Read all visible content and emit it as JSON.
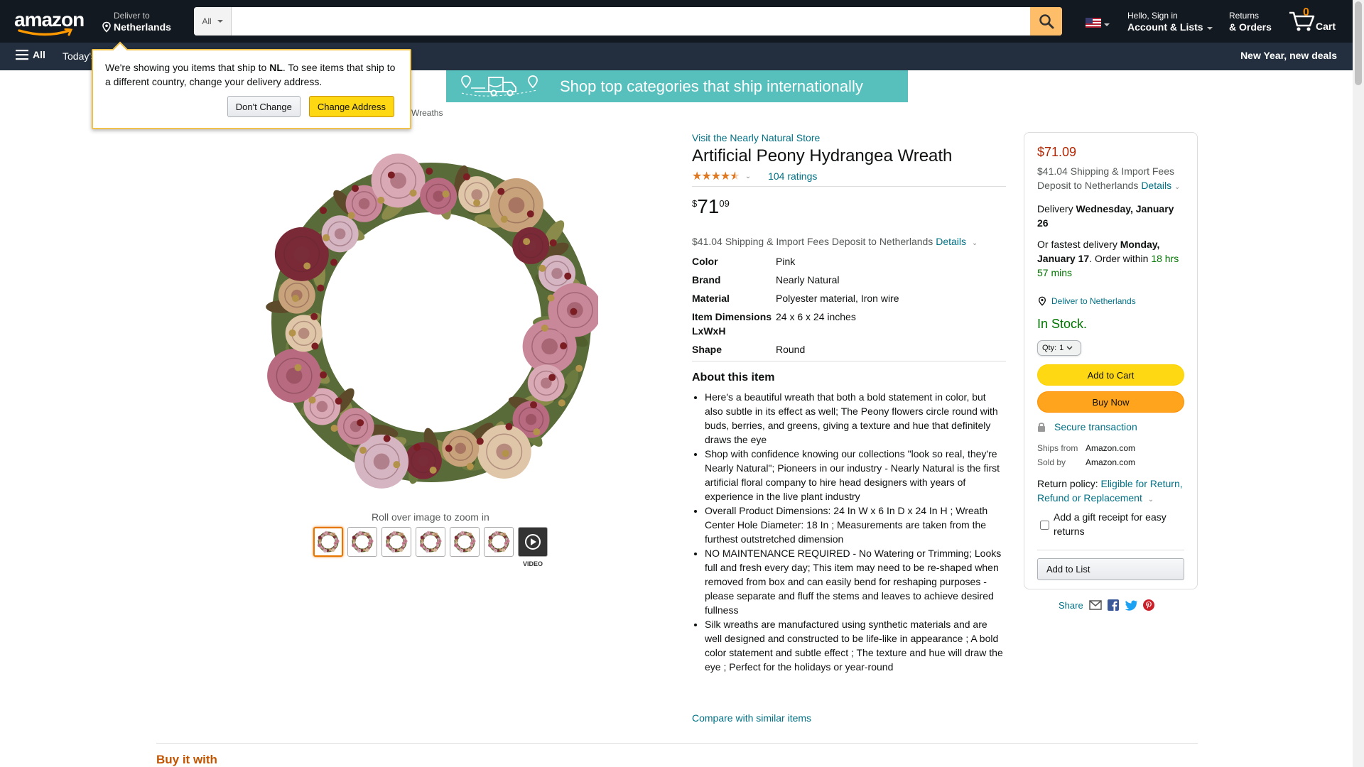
{
  "nav": {
    "logo_text": "amazon",
    "deliver_line1": "Deliver to",
    "deliver_line2": "Netherlands",
    "search_category": "All",
    "search_placeholder": "",
    "account_line1": "Hello, Sign in",
    "account_line2": "Account & Lists",
    "returns_line1": "Returns",
    "returns_line2": "& Orders",
    "cart_count": "0",
    "cart_label": "Cart",
    "all_label": "All",
    "today_label": "Today's",
    "promo": "New Year, new deals"
  },
  "popover": {
    "msg_prefix": "We're showing you items that ship to ",
    "msg_country": "NL",
    "msg_suffix": ". To see items that ship to a different country, change your delivery address.",
    "dont_change": "Don't Change",
    "change_address": "Change Address"
  },
  "banner": {
    "text": "Shop top categories that ship internationally"
  },
  "breadcrumb": "Wreaths",
  "gallery": {
    "zoom_hint": "Roll over image to zoom in",
    "video_label": "VIDEO",
    "thumb_count": 7
  },
  "product": {
    "store_link": "Visit the Nearly Natural Store",
    "title": "Artificial Peony Hydrangea Wreath",
    "rating_value": 4.5,
    "ratings": "104 ratings",
    "price_symbol": "$",
    "price_whole": "71",
    "price_fraction": "09",
    "shipping_text": "$41.04 Shipping & Import Fees Deposit to Netherlands",
    "details_link": "Details",
    "attributes": [
      {
        "k": "Color",
        "v": "Pink"
      },
      {
        "k": "Brand",
        "v": "Nearly Natural"
      },
      {
        "k": "Material",
        "v": "Polyester material, Iron wire"
      },
      {
        "k": "Item Dimensions LxWxH",
        "v": "24 x 6 x 24 inches"
      },
      {
        "k": "Shape",
        "v": "Round"
      }
    ],
    "about_heading": "About this item",
    "bullets": [
      "Here's a beautiful wreath that both a bold statement in color, but also subtle in its effect as well; The Peony flowers circle round with buds, berries, and greens, giving a texture and hue that definitely draws the eye",
      "Shop with confidence knowing our collections \"look so real, they're Nearly Natural\"; Pioneers in our industry - Nearly Natural is the first artificial floral company to hire head designers with years of experience in the live plant industry",
      "Overall Product Dimensions: 24 In W x 6 In D x 24 In H ; Wreath Center Hole Diameter: 18 In ; Measurements are taken from the furthest outstretched dimension",
      "NO MAINTENANCE REQUIRED - No Watering or Trimming; Looks full and fresh every day; This item may need to be re-shaped when removed from box and can easily bend for reshaping purposes - please separate and fluff the stems and leaves to achieve desired fullness",
      "Silk wreaths are manufactured using synthetic materials and are well designed and constructed to be life-like in appearance ; A bold color statement and subtle effect ; The texture and hue will draw the eye ; Perfect for the holidays or year-round"
    ],
    "compare_link": "Compare with similar items"
  },
  "buybox": {
    "price": "$71.09",
    "shipping_line": "$41.04 Shipping & Import Fees Deposit to Netherlands",
    "details_link": "Details",
    "delivery_prefix": "Delivery ",
    "delivery_date": "Wednesday, January 26",
    "fastest_prefix": "Or fastest delivery ",
    "fastest_date": "Monday, January 17",
    "order_within": ". Order within ",
    "countdown": "18 hrs 57 mins",
    "deliver_to": "Deliver to Netherlands",
    "stock": "In Stock.",
    "qty_label": "Qty:",
    "qty_value": "1",
    "add_to_cart": "Add to Cart",
    "buy_now": "Buy Now",
    "secure": "Secure transaction",
    "ships_from_k": "Ships from",
    "ships_from_v": "Amazon.com",
    "sold_by_k": "Sold by",
    "sold_by_v": "Amazon.com",
    "return_prefix": "Return policy: ",
    "return_link": "Eligible for Return, Refund or Replacement",
    "gift_label": "Add a gift receipt for easy returns",
    "add_to_list": "Add to List",
    "share": "Share"
  },
  "bottom": {
    "buy_with": "Buy it with"
  },
  "colors": {
    "nav_bg": "#131921",
    "subnav_bg": "#232f3e",
    "link": "#007185",
    "price": "#b12704",
    "stock_green": "#007600",
    "cart_yellow": "#ffd814",
    "buy_orange": "#ffa41c"
  }
}
